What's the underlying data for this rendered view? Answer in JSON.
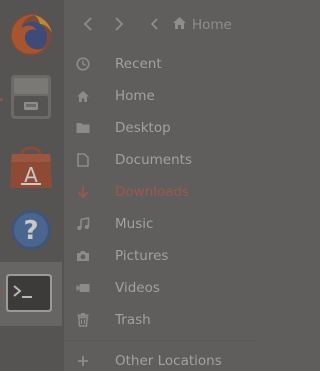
{
  "header": {
    "back_icon": "chevron-left-icon",
    "forward_icon": "chevron-right-icon",
    "path_toggle_icon": "chevron-left-icon",
    "path_home_icon": "home-icon",
    "path_home_label": "Home"
  },
  "dock": {
    "items": [
      {
        "name": "firefox",
        "icon": "firefox-icon",
        "running": false
      },
      {
        "name": "files",
        "icon": "file-cabinet-icon",
        "running": true
      },
      {
        "name": "software",
        "icon": "shopping-bag-icon",
        "running": false
      },
      {
        "name": "help",
        "icon": "help-icon",
        "running": false
      },
      {
        "name": "terminal",
        "icon": "terminal-icon",
        "running": true,
        "active": true
      }
    ]
  },
  "sidebar": {
    "places": [
      {
        "label": "Recent",
        "icon": "clock-icon"
      },
      {
        "label": "Home",
        "icon": "home-icon"
      },
      {
        "label": "Desktop",
        "icon": "folder-icon"
      },
      {
        "label": "Documents",
        "icon": "document-icon"
      },
      {
        "label": "Downloads",
        "icon": "download-arrow-icon",
        "active": true
      },
      {
        "label": "Music",
        "icon": "music-note-icon"
      },
      {
        "label": "Pictures",
        "icon": "camera-icon"
      },
      {
        "label": "Videos",
        "icon": "video-camera-icon"
      },
      {
        "label": "Trash",
        "icon": "trash-icon"
      }
    ],
    "other_locations": {
      "label": "Other Locations",
      "icon": "plus-icon"
    }
  },
  "colors": {
    "accent": "#9e5848",
    "text": "#a2a19f",
    "background": "#5f5e5c",
    "dock": "#555452"
  }
}
